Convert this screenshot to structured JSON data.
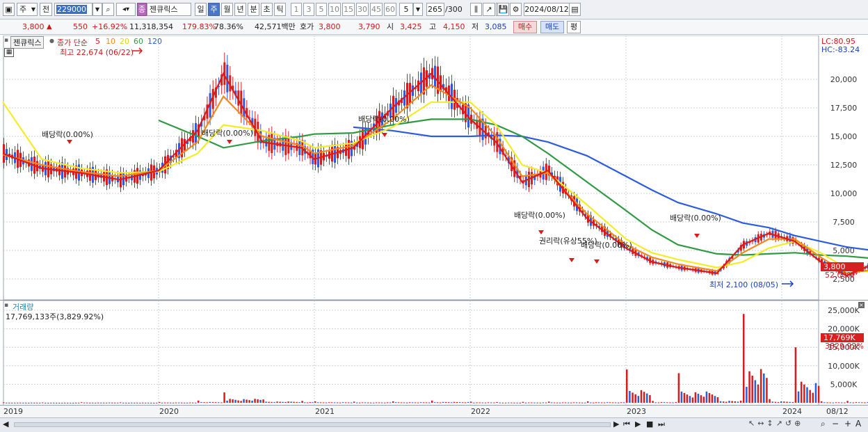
{
  "toolbar": {
    "market": "주",
    "scope": "전",
    "code": "229000",
    "stock_name": "젠큐릭스",
    "stock_badge": "종",
    "period_buttons": [
      "일",
      "주",
      "월",
      "년",
      "분",
      "초",
      "틱"
    ],
    "active_period": "주",
    "minute_buttons": [
      "1",
      "3",
      "5",
      "10",
      "15",
      "30",
      "45",
      "60"
    ],
    "interval_value": "5",
    "count": "265",
    "count_total": "/300",
    "date": "2024/08/12"
  },
  "quote": {
    "price": "3,800",
    "change": "550",
    "change_pct": "+16.92%",
    "volume": "11,318,354",
    "volume_ratio": "179.83%",
    "turnover_pct": "78.36%",
    "trade_value": "42,571백만",
    "ask_label": "호가",
    "ask": "3,800",
    "bid": "3,790",
    "open_label": "시",
    "open": "3,425",
    "high_label": "고",
    "high": "4,150",
    "low_label": "저",
    "low": "3,085",
    "buy_button": "매수",
    "sell_button": "매도",
    "eval_button": "평"
  },
  "price_pane": {
    "tab_name": "젠큐릭스",
    "legend_prefix": "종가 단순",
    "ma_periods": [
      "5",
      "10",
      "20",
      "60",
      "120"
    ],
    "high_note": "최고 22,674 (06/22)",
    "low_note": "최저 2,100 (08/05)",
    "lc": "LC:80.95",
    "hc": "HC:-83.24",
    "current_price_tag": "3,800",
    "current_pct_tag": "52.00%",
    "y_ticks": [
      "20,000",
      "17,500",
      "15,000",
      "12,500",
      "10,000",
      "7,500",
      "5,000",
      "2,500"
    ],
    "annotations": [
      "배당락(0.00%)",
      "배당락(0.00%)",
      "배당락(0.00%)",
      "배당락(0.00%)",
      "배당락(0.00%)",
      "권리락(유상55%)",
      "배당락(0.00%)"
    ]
  },
  "volume_pane": {
    "title": "거래량",
    "value": "17,769,133주(3,829.92%)",
    "y_ticks": [
      "25,000K",
      "20,000K",
      "15,000K",
      "10,000K",
      "5,000K"
    ],
    "current_tag": "17,769K",
    "current_pct_tag": "3829.92%"
  },
  "date_axis": {
    "labels": [
      "2019",
      "2020",
      "2021",
      "2022",
      "2023",
      "2024"
    ],
    "right_label": "08/12"
  },
  "chart_data": {
    "type": "line",
    "title": "",
    "xlabel": "",
    "ylabel": "",
    "ylim": [
      1500,
      22500
    ],
    "x": [
      "2019-01",
      "2019-04",
      "2019-07",
      "2019-10",
      "2020-01",
      "2020-04",
      "2020-06",
      "2020-09",
      "2020-12",
      "2021-01",
      "2021-04",
      "2021-07",
      "2021-10",
      "2022-01",
      "2022-03",
      "2022-05",
      "2022-07",
      "2022-10",
      "2023-01",
      "2023-03",
      "2023-05",
      "2023-08",
      "2023-10",
      "2023-12",
      "2024-02",
      "2024-04",
      "2024-06",
      "2024-08"
    ],
    "series": [
      {
        "name": "5",
        "color": "#d81c1c",
        "values": [
          13500,
          12200,
          11800,
          11200,
          12000,
          15500,
          20500,
          14500,
          14000,
          13000,
          14000,
          17500,
          20500,
          16500,
          14500,
          11000,
          12000,
          7800,
          5200,
          4000,
          3500,
          3000,
          5500,
          6500,
          5800,
          4000,
          2800,
          3800
        ]
      },
      {
        "name": "10",
        "color": "#f08a1c",
        "values": [
          13400,
          12500,
          11900,
          11500,
          12000,
          14500,
          18500,
          15000,
          14200,
          13500,
          14200,
          16500,
          19500,
          17500,
          15000,
          11500,
          11800,
          8200,
          5500,
          4400,
          3800,
          3200,
          4800,
          6000,
          6000,
          4400,
          3000,
          3300
        ]
      },
      {
        "name": "20",
        "color": "#f3ec27",
        "values": [
          18000,
          13000,
          12200,
          11800,
          11900,
          13500,
          16000,
          15500,
          14600,
          14000,
          14400,
          15800,
          18000,
          18000,
          16000,
          12500,
          11800,
          9000,
          6000,
          4800,
          4200,
          3500,
          4000,
          5200,
          5800,
          4800,
          3400,
          3100
        ]
      },
      {
        "name": "60",
        "color": "#2f9a44",
        "values": [
          null,
          null,
          null,
          null,
          16400,
          15000,
          14000,
          14600,
          15000,
          15200,
          15300,
          16000,
          16500,
          16500,
          16000,
          15000,
          13500,
          11000,
          8500,
          6800,
          5500,
          4700,
          4600,
          4700,
          4800,
          4600,
          4500,
          4300
        ]
      },
      {
        "name": "120",
        "color": "#2c5be0",
        "values": [
          null,
          null,
          null,
          null,
          null,
          null,
          null,
          null,
          null,
          null,
          15800,
          15500,
          15000,
          15000,
          15100,
          15000,
          14500,
          13300,
          11500,
          10300,
          9200,
          8200,
          7400,
          7000,
          6300,
          5800,
          5300,
          5000
        ]
      }
    ],
    "volume_k": [
      120,
      80,
      150,
      100,
      200,
      600,
      2800,
      900,
      500,
      400,
      300,
      400,
      600,
      300,
      200,
      250,
      300,
      400,
      9000,
      500,
      8000,
      1500,
      24000,
      1000,
      15000,
      400,
      500,
      17769
    ]
  }
}
